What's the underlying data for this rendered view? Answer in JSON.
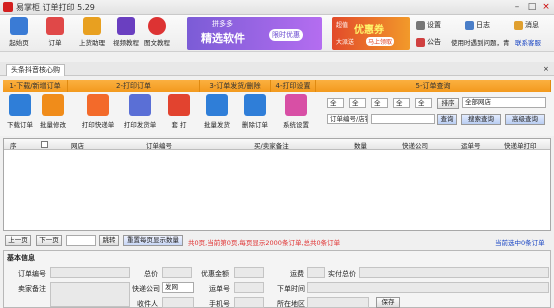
{
  "app": {
    "title": "易掌柜 订单打印 5.29"
  },
  "toolbar": {
    "items": [
      {
        "label": "起始页"
      },
      {
        "label": "订单"
      },
      {
        "label": "上货助理"
      },
      {
        "label": "视频教程"
      },
      {
        "label": "图文教程"
      }
    ]
  },
  "ads": {
    "pdd": {
      "small": "拼多多",
      "big": "精选软件",
      "pill": "限时优惠"
    },
    "coupon": {
      "a": "超值",
      "b": "优惠券",
      "c": "大派送",
      "d": "马上领取"
    }
  },
  "topright": {
    "settings": "设置",
    "log": "日志",
    "message": "消息",
    "notice": "公告",
    "user": "使用时遇到问题，青",
    "contact": "联系客服"
  },
  "tab": {
    "label": "头条抖音核心购"
  },
  "groups": {
    "g1": "1-下载/新增订单",
    "g2": "2-打印订单",
    "g3": "3-订单发货/删除",
    "g4": "4-打印设置",
    "g5": "5-订单查询"
  },
  "buttons": {
    "download": "下载订单",
    "batch_edit": "批量修改",
    "print_express": "打印快递单",
    "print_invoice": "打印发货单",
    "print": "套 打",
    "batch_ship": "批量发货",
    "delete": "删除订单",
    "sys_settings": "系统设置"
  },
  "query": {
    "sel1": "全",
    "sel2": "全",
    "sel3": "全",
    "sel4": "全",
    "sel5": "全",
    "sort": "排序",
    "shop": "全部网店",
    "field": "订单编号/店铺",
    "query": "查询",
    "advanced": "搜索查询",
    "advanced2": "高级查询"
  },
  "grid": {
    "columns": [
      "序",
      "",
      "网店",
      "订单编号",
      "买/卖家备注",
      "数量",
      "快递公司",
      "运单号",
      "快递单打印"
    ]
  },
  "pager": {
    "prev": "上一页",
    "next": "下一页",
    "jump": "跳转",
    "refresh": "重置每页显示数量",
    "status": "共0页,当前第0页,每页显示2000条订单,总共0条订单",
    "selected": "当前选中0条订单"
  },
  "basic": {
    "title": "基本信息",
    "order_no": "订单编号",
    "total": "总价",
    "discount": "优惠金额",
    "postage": "运费",
    "paid": "实付总价",
    "buyer_note": "卖家备注",
    "express_co": "快递公司",
    "express_value": "发网",
    "waybill": "运单号",
    "order_time": "下单时间",
    "receiver": "收件人",
    "phone": "手机号",
    "region": "所在地区",
    "save": "保存"
  }
}
